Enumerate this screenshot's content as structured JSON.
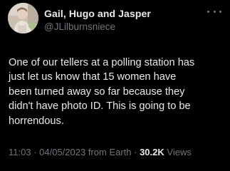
{
  "tweet": {
    "author": {
      "display_name": "Gail, Hugo and Jasper",
      "handle": "@JLilburnsniece"
    },
    "text": "One of our tellers at a polling station has\njust let us know that 15 women have\nbeen turned away so far because they\ndidn't have photo ID.  This is going to be\nhorrendous.",
    "meta": {
      "time": "11:03",
      "sep1": " · ",
      "date": "04/05/2023",
      "source": " from Earth",
      "sep2": " · ",
      "views_count": "30.2K",
      "views_label": " Views"
    }
  },
  "icons": {
    "more": "more-horizontal-icon",
    "avatar": "profile-photo"
  },
  "colors": {
    "background": "#000000",
    "primary_text": "#e7e9ea",
    "secondary_text": "#71767b"
  }
}
